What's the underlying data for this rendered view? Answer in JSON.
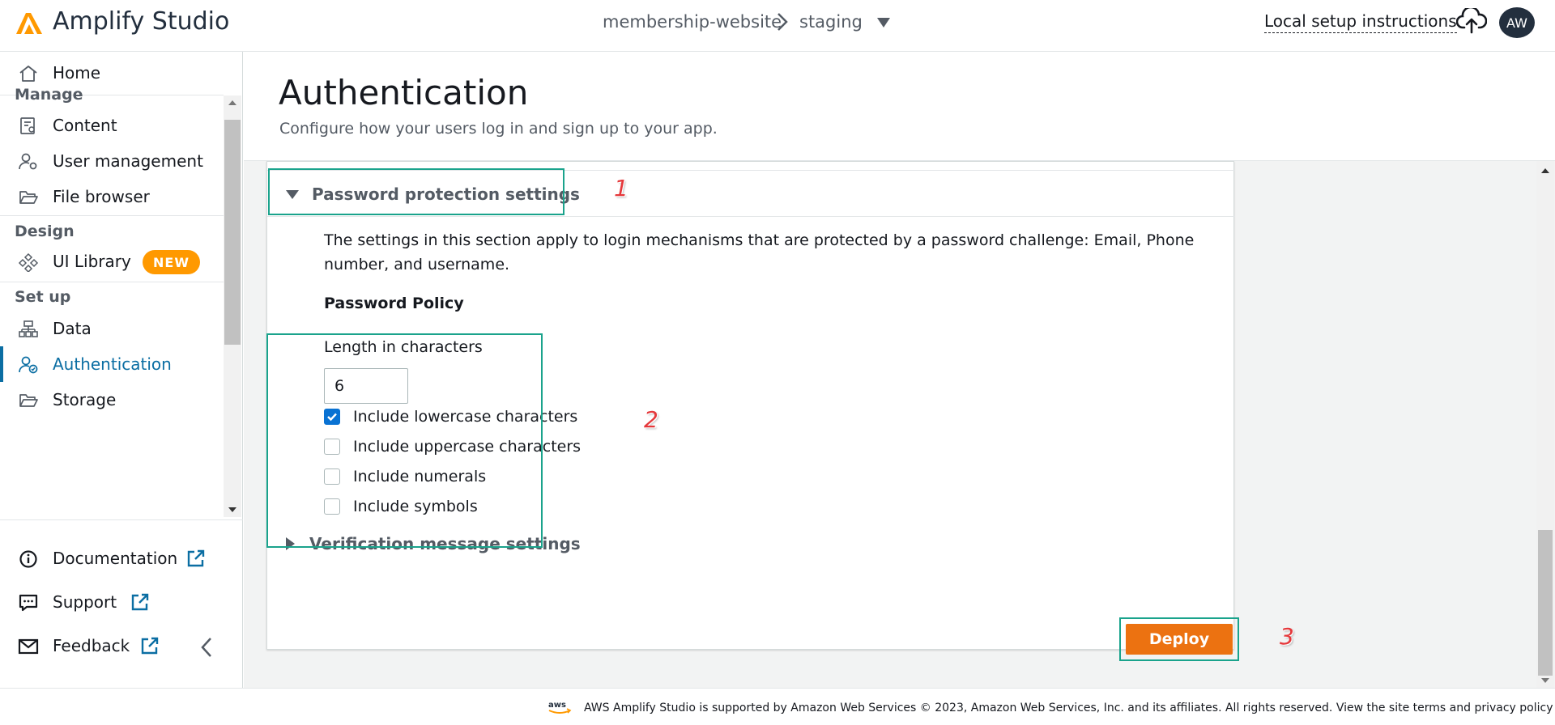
{
  "header": {
    "app_name": "Amplify Studio",
    "breadcrumb_app": "membership-website",
    "breadcrumb_env": "staging",
    "local_setup": "Local setup instructions",
    "avatar_initials": "AW"
  },
  "sidebar": {
    "home": "Home",
    "manage_title": "Manage",
    "content": "Content",
    "user_management": "User management",
    "file_browser": "File browser",
    "design_title": "Design",
    "ui_library": "UI Library",
    "new_badge": "NEW",
    "setup_title": "Set up",
    "data": "Data",
    "authentication": "Authentication",
    "storage": "Storage",
    "documentation": "Documentation",
    "support": "Support",
    "feedback": "Feedback",
    "active_item": "Authentication"
  },
  "page": {
    "title": "Authentication",
    "description": "Configure how your users log in and sign up to your app."
  },
  "password_section": {
    "header": "Password protection settings",
    "expanded": true,
    "description": "The settings in this section apply to login mechanisms that are protected by a password challenge: Email, Phone number, and username.",
    "policy_title": "Password Policy",
    "length_label": "Length in characters",
    "length_value": "6",
    "options": [
      {
        "label": "Include lowercase characters",
        "checked": true
      },
      {
        "label": "Include uppercase characters",
        "checked": false
      },
      {
        "label": "Include numerals",
        "checked": false
      },
      {
        "label": "Include symbols",
        "checked": false
      }
    ]
  },
  "verification_section": {
    "header": "Verification message settings",
    "expanded": false
  },
  "actions": {
    "deploy": "Deploy"
  },
  "annotations": [
    "1",
    "2",
    "3"
  ],
  "footer": {
    "text": "AWS Amplify Studio is supported by Amazon Web Services © 2023, Amazon Web Services, Inc. and its affiliates. All rights reserved. View the site terms and privacy policy ."
  },
  "colors": {
    "accent": "#0b6ea3",
    "brand_orange": "#ff9900",
    "deploy_orange": "#ec7211",
    "highlight": "#1aa38c",
    "annotation": "#e5383b"
  }
}
